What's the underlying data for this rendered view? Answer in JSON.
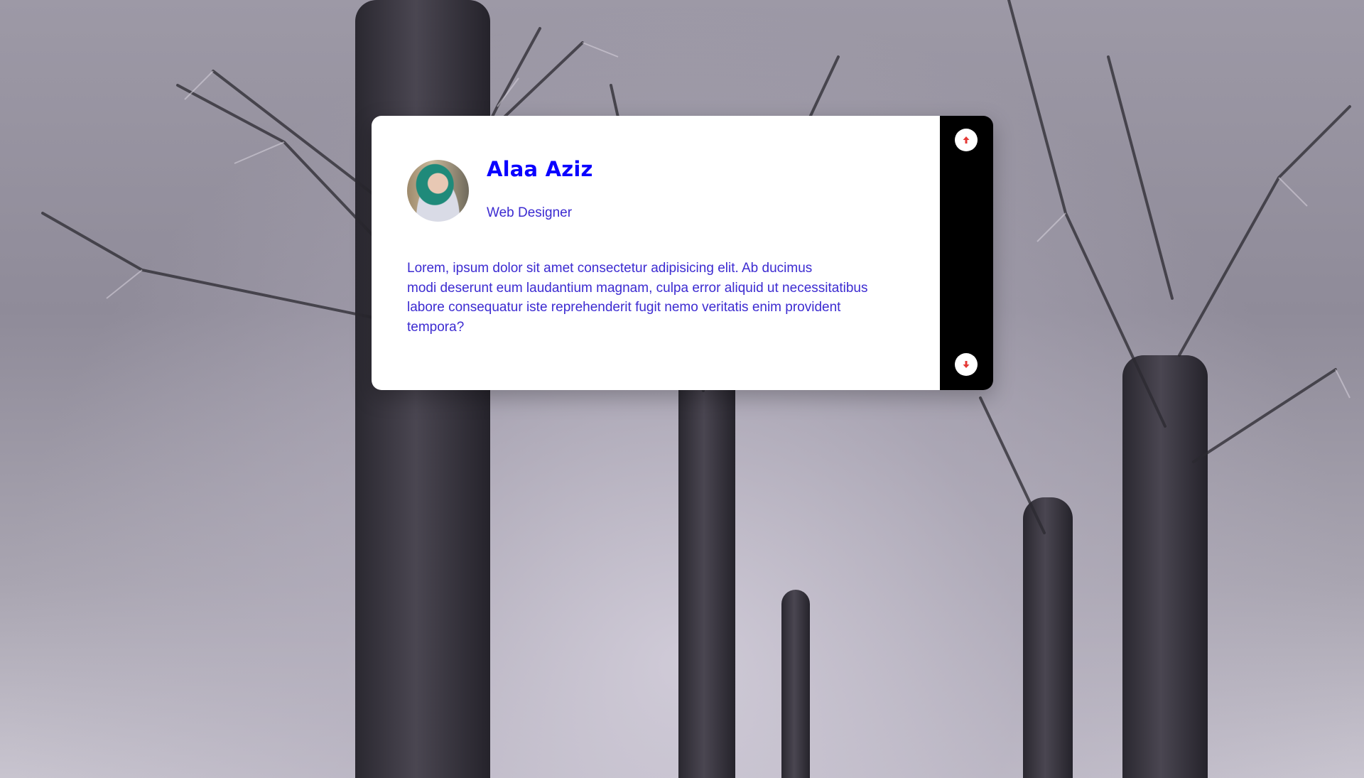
{
  "card": {
    "name": "Alaa Aziz",
    "role": "Web Designer",
    "bio_lines": [
      "Lorem, ipsum dolor sit amet consectetur adipisicing elit. Ab ducimus",
      "modi deserunt eum laudantium magnam, culpa error aliquid ut necessitatibus",
      "labore consequatur iste reprehenderit fugit nemo veritatis enim provident",
      "tempora?"
    ]
  },
  "nav": {
    "up_icon": "arrow-up-icon",
    "down_icon": "arrow-down-icon",
    "icon_color": "#e53935"
  },
  "colors": {
    "name": "#0a00ff",
    "text": "#3c2bd1",
    "sidebar": "#000000"
  }
}
